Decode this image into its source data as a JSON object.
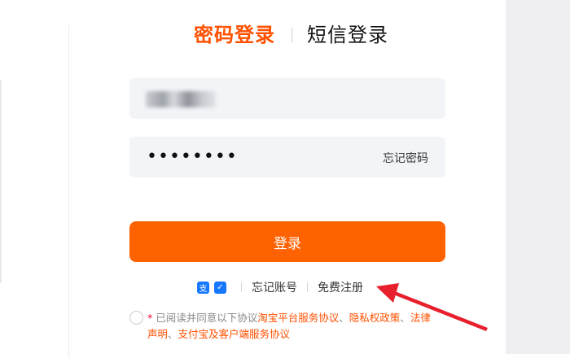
{
  "tabs": {
    "password_login": "密码登录",
    "sms_login": "短信登录"
  },
  "account_field": {
    "value_obscured": true
  },
  "password_field": {
    "masked_value": "••••••••",
    "forgot_password": "忘记密码"
  },
  "login_button": "登录",
  "links": {
    "alipay_icon": "支",
    "app_icon": "✓",
    "forgot_account": "忘记账号",
    "free_register": "免费注册"
  },
  "agreement": {
    "required_mark": "*",
    "prefix": "已阅读并同意以下协议",
    "link1": "淘宝平台服务协议",
    "sep1": "、",
    "link2": "隐私权政策",
    "sep2": "、",
    "link3": "法律声明",
    "sep3": "、",
    "link4": "支付宝及客户端服务协议"
  },
  "colors": {
    "accent": "#ff5000",
    "button": "#ff6200",
    "field_bg": "#f2f4f7",
    "annotation_arrow": "#e8202e"
  }
}
